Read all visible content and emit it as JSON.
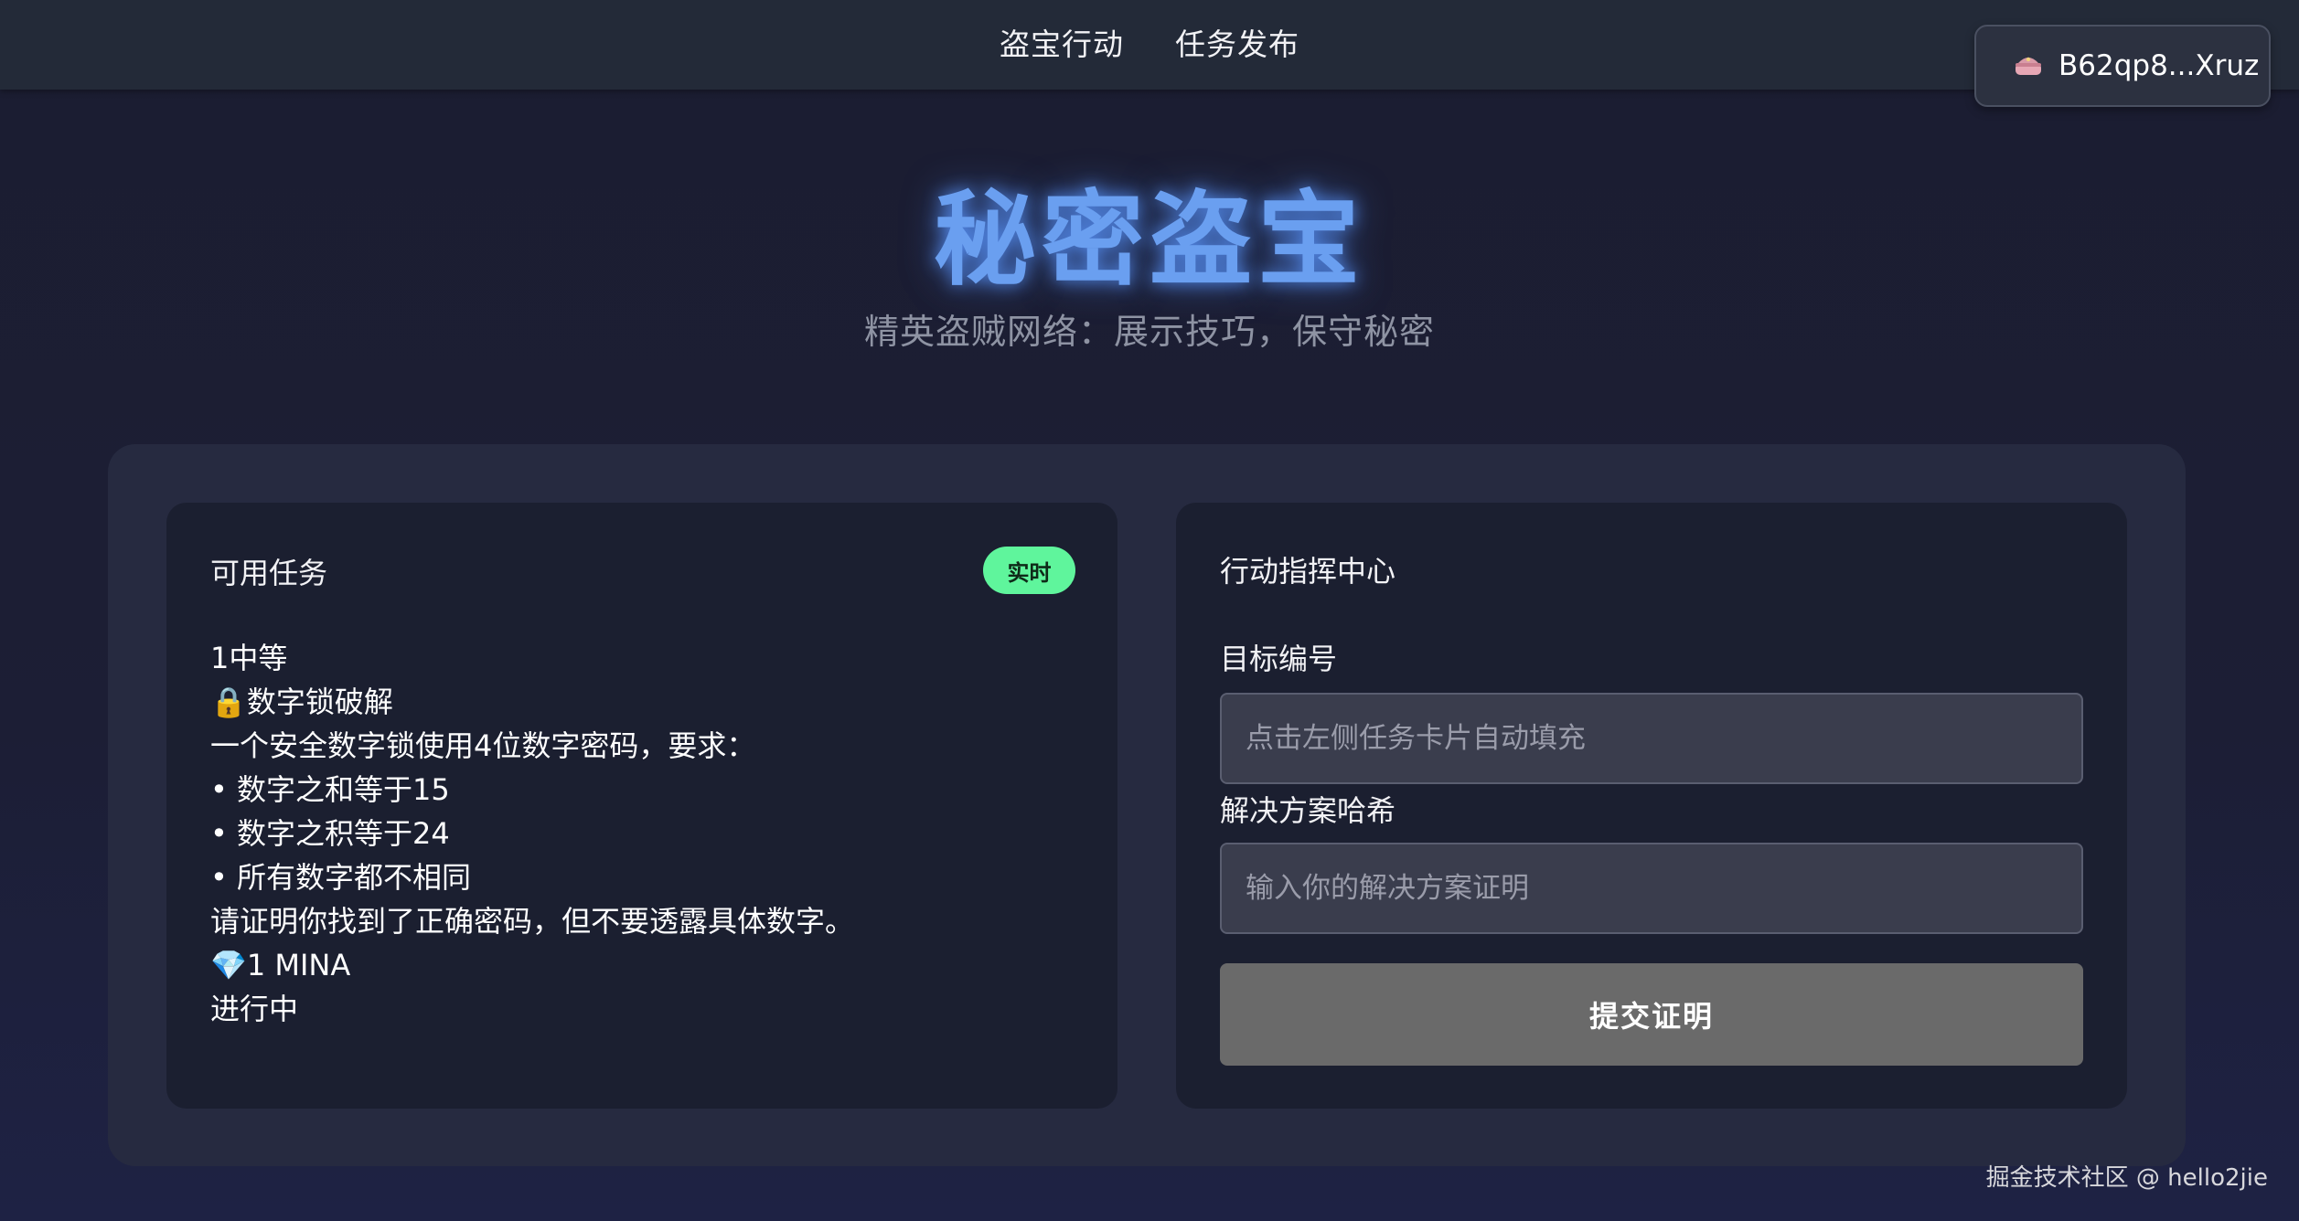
{
  "nav": {
    "items": [
      "盗宝行动",
      "任务发布"
    ]
  },
  "wallet": {
    "icon": "purse-icon",
    "address": "B62qp8...Xruz"
  },
  "hero": {
    "title": "秘密盗宝",
    "subtitle": "精英盗贼网络：展示技巧，保守秘密"
  },
  "tasks_card": {
    "title": "可用任务",
    "badge": "实时",
    "badge_color": "#5ff59c",
    "task": {
      "id_line": "1中等",
      "name": "🔒数字锁破解",
      "description": "一个安全数字锁使用4位数字密码，要求：",
      "requirements": [
        "• 数字之和等于15",
        "• 数字之积等于24",
        "• 所有数字都不相同"
      ],
      "note": "请证明你找到了正确密码，但不要透露具体数字。",
      "reward": "💎1 MINA",
      "status": "进行中"
    }
  },
  "command_card": {
    "title": "行动指挥中心",
    "target_label": "目标编号",
    "target_placeholder": "点击左侧任务卡片自动填充",
    "solution_label": "解决方案哈希",
    "solution_placeholder": "输入你的解决方案证明",
    "submit_label": "提交证明"
  },
  "watermark": "掘金技术社区 @ hello2jie",
  "colors": {
    "accent_title": "#6a9ff0",
    "button_gray": "#6a6a6a"
  }
}
